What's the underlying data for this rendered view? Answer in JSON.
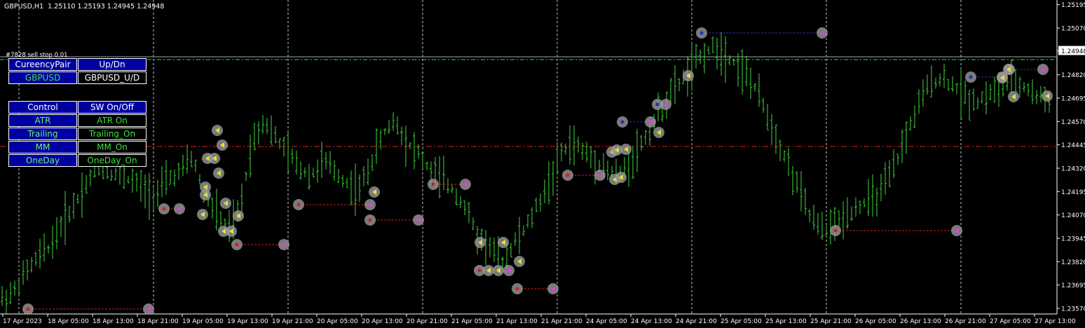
{
  "header": {
    "symbol": "GBPUSD,H1",
    "ohlc": "1.25110 1.25193 1.24945 1.24948"
  },
  "order_label": "#7828 sell stop 0.01",
  "panel1": {
    "header": [
      "CureencyPair",
      "Up/Dn"
    ],
    "row": [
      "GBPUSD",
      "GBPUSD_U/D"
    ]
  },
  "panel2": {
    "header": [
      "Control",
      "SW On/Off"
    ],
    "rows": [
      [
        "ATR",
        "ATR On"
      ],
      [
        "Trailing",
        "Trailing_On"
      ],
      [
        "MM",
        "MM_On"
      ],
      [
        "OneDay",
        "OneDay_On"
      ]
    ]
  },
  "price_axis": [
    "1.25195",
    "1.25070",
    "1.24948",
    "1.24820",
    "1.24695",
    "1.24570",
    "1.24445",
    "1.24320",
    "1.24195",
    "1.24070",
    "1.23945",
    "1.23820",
    "1.23695",
    "1.23570"
  ],
  "current_price": "1.24948",
  "time_axis": [
    "17 Apr 2023",
    "18 Apr 05:00",
    "18 Apr 13:00",
    "18 Apr 21:00",
    "19 Apr 05:00",
    "19 Apr 13:00",
    "19 Apr 21:00",
    "20 Apr 05:00",
    "20 Apr 13:00",
    "20 Apr 21:00",
    "21 Apr 05:00",
    "21 Apr 13:00",
    "21 Apr 21:00",
    "24 Apr 05:00",
    "24 Apr 13:00",
    "24 Apr 21:00",
    "25 Apr 05:00",
    "25 Apr 13:00",
    "25 Apr 21:00",
    "26 Apr 05:00",
    "26 Apr 13:00",
    "26 Apr 21:00",
    "27 Apr 05:00",
    "27 Apr 13:00"
  ],
  "colors": {
    "bar": "#3fd43f",
    "grid": "#c8c8c8",
    "sell_line": "#d02020",
    "buy_line": "#2030c0",
    "current_line": "#9aa8a8",
    "order_line": "#3fd43f"
  },
  "chart_data": {
    "type": "ohlc",
    "series": "GBPUSD H1",
    "ylim": [
      1.2354,
      1.2522
    ],
    "close_path": [
      1.2362,
      1.2366,
      1.2376,
      1.2384,
      1.239,
      1.2402,
      1.2412,
      1.2423,
      1.2432,
      1.243,
      1.2428,
      1.2425,
      1.242,
      1.2418,
      1.2426,
      1.243,
      1.2438,
      1.2418,
      1.2408,
      1.2398,
      1.241,
      1.2446,
      1.2458,
      1.2448,
      1.244,
      1.2432,
      1.2428,
      1.2436,
      1.243,
      1.2424,
      1.242,
      1.2435,
      1.245,
      1.2458,
      1.2446,
      1.244,
      1.243,
      1.2426,
      1.242,
      1.241,
      1.2395,
      1.239,
      1.2382,
      1.2392,
      1.24,
      1.2412,
      1.2425,
      1.244,
      1.2446,
      1.244,
      1.2436,
      1.243,
      1.2428,
      1.2438,
      1.2448,
      1.246,
      1.247,
      1.2478,
      1.2486,
      1.2494,
      1.2497,
      1.2492,
      1.2486,
      1.2478,
      1.2465,
      1.245,
      1.2435,
      1.242,
      1.2405,
      1.2398,
      1.2402,
      1.2408,
      1.2412,
      1.2415,
      1.242,
      1.2432,
      1.245,
      1.2465,
      1.2478,
      1.248,
      1.2476,
      1.247,
      1.2468,
      1.2472,
      1.2475,
      1.2478,
      1.2475,
      1.247,
      1.247
    ]
  }
}
